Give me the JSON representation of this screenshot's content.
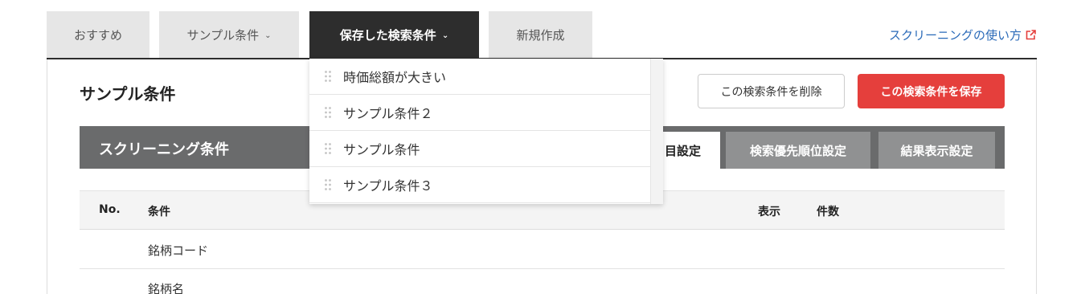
{
  "top_tabs": [
    {
      "label": "おすすめ",
      "has_chevron": false
    },
    {
      "label": "サンプル条件",
      "has_chevron": true
    },
    {
      "label": "保存した検索条件",
      "has_chevron": true
    },
    {
      "label": "新規作成",
      "has_chevron": false
    }
  ],
  "active_tab_index": 2,
  "chevron_glyph": "⌄",
  "help_link": {
    "label": "スクリーニングの使い方",
    "icon": "external-link-icon"
  },
  "page": {
    "title": "サンプル条件"
  },
  "buttons": {
    "delete": "この検索条件を削除",
    "save": "この検索条件を保存"
  },
  "screening": {
    "title": "スクリーニング条件",
    "tabs": [
      "目設定",
      "検索優先順位設定",
      "結果表示設定"
    ]
  },
  "table": {
    "headers": {
      "no": "No.",
      "condition": "条件",
      "display": "表示",
      "count": "件数"
    },
    "rows": [
      "銘柄コード",
      "銘柄名"
    ]
  },
  "dropdown": {
    "items": [
      "時価総額が大きい",
      "サンプル条件２",
      "サンプル条件",
      "サンプル条件３"
    ]
  },
  "colors": {
    "active_tab": "#2d2d2d",
    "tab_bg": "#e6e6e6",
    "save_button": "#e53f3c",
    "link": "#2a6ab8",
    "external_icon": "#e53f3c",
    "screening_bar": "#6a6b6c"
  }
}
